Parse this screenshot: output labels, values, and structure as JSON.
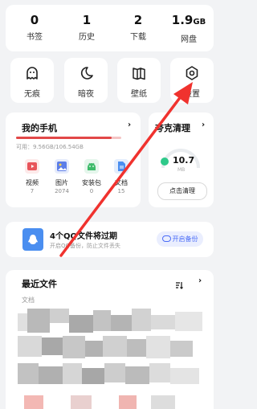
{
  "stats": [
    {
      "value": "0",
      "unit": "",
      "label": "书签"
    },
    {
      "value": "1",
      "unit": "",
      "label": "历史"
    },
    {
      "value": "2",
      "unit": "",
      "label": "下载"
    },
    {
      "value": "1.9",
      "unit": "GB",
      "label": "网盘"
    }
  ],
  "quick": [
    {
      "label": "无痕",
      "icon": "ghost-icon"
    },
    {
      "label": "暗夜",
      "icon": "moon-icon"
    },
    {
      "label": "壁纸",
      "icon": "book-icon"
    },
    {
      "label": "设置",
      "icon": "gear-icon"
    }
  ],
  "phone": {
    "title": "我的手机",
    "chevron": "›",
    "usage": "可用：9.56GB/106.54GB",
    "used_fraction": 0.91,
    "items": [
      {
        "label": "视频",
        "count": "7",
        "color": "#e8545a",
        "icon": "video-icon"
      },
      {
        "label": "图片",
        "count": "2074",
        "color": "#5b7de8",
        "icon": "image-icon"
      },
      {
        "label": "安装包",
        "count": "0",
        "color": "#3dbb6a",
        "icon": "android-icon"
      },
      {
        "label": "文档",
        "count": "15",
        "color": "#4a8ef0",
        "icon": "document-icon"
      }
    ]
  },
  "cleaner": {
    "title": "夸克清理",
    "chevron": "›",
    "value": "10.7",
    "unit": "MB",
    "button": "点击清理",
    "accent": "#2ec98a"
  },
  "banner": {
    "title": "4个QQ文件将过期",
    "subtitle": "开启QQ备份，防止文件丢失",
    "button": "开启备份",
    "accent": "#4a6cf7"
  },
  "recent": {
    "title": "最近文件",
    "section": "文档",
    "chevron": "›"
  },
  "arrow_color": "#f0322e"
}
